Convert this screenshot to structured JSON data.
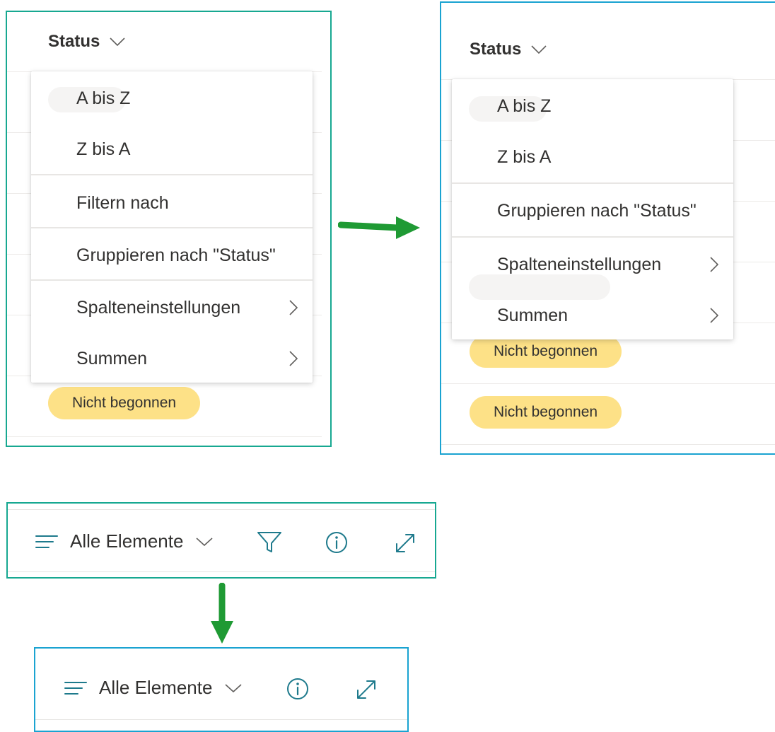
{
  "column_menu_before": {
    "header_label": "Status",
    "items": [
      {
        "label": "A bis Z"
      },
      {
        "label": "Z bis A"
      },
      {
        "label": "Filtern nach"
      },
      {
        "label": "Gruppieren nach \"Status\""
      },
      {
        "label": "Spalteneinstellungen",
        "submenu": true
      },
      {
        "label": "Summen",
        "submenu": true
      }
    ],
    "badges": [
      "Nicht begonnen"
    ]
  },
  "column_menu_after": {
    "header_label": "Status",
    "items": [
      {
        "label": "A bis Z"
      },
      {
        "label": "Z bis A"
      },
      {
        "label": "Gruppieren nach \"Status\""
      },
      {
        "label": "Spalteneinstellungen",
        "submenu": true
      },
      {
        "label": "Summen",
        "submenu": true
      }
    ],
    "badges": [
      "Nicht begonnen",
      "Nicht begonnen"
    ]
  },
  "toolbar_before": {
    "view_label": "Alle Elemente",
    "icons": [
      "view-list-icon",
      "chevron-down-icon",
      "filter-icon",
      "info-icon",
      "expand-icon"
    ]
  },
  "toolbar_after": {
    "view_label": "Alle Elemente",
    "icons": [
      "view-list-icon",
      "chevron-down-icon",
      "info-icon",
      "expand-icon"
    ]
  },
  "colors": {
    "before_frame": "#17a891",
    "after_frame": "#1aa3d1",
    "arrow": "#1f9a34",
    "status_badge": "#fde187",
    "icon_accent": "#1e7a8c"
  }
}
